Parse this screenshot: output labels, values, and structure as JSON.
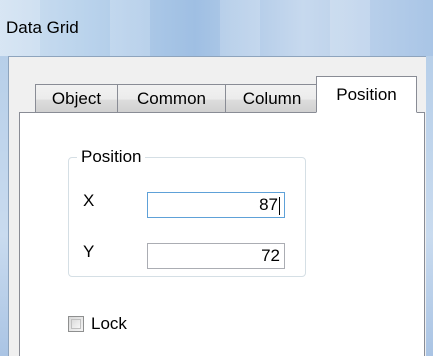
{
  "window": {
    "title": "Data Grid"
  },
  "tabs": [
    {
      "label": "Object",
      "active": false
    },
    {
      "label": "Common",
      "active": false
    },
    {
      "label": "Column",
      "active": false
    },
    {
      "label": "Position",
      "active": true
    }
  ],
  "position_group": {
    "legend": "Position",
    "x_label": "X",
    "x_value": "87",
    "y_label": "Y",
    "y_value": "72"
  },
  "lock": {
    "label": "Lock",
    "checked": false
  },
  "colors": {
    "titlebar": "#bad3ec",
    "panel_bg": "#ffffff",
    "dialog_bg": "#f0f0f0",
    "focus_border": "#5ea1d8"
  }
}
